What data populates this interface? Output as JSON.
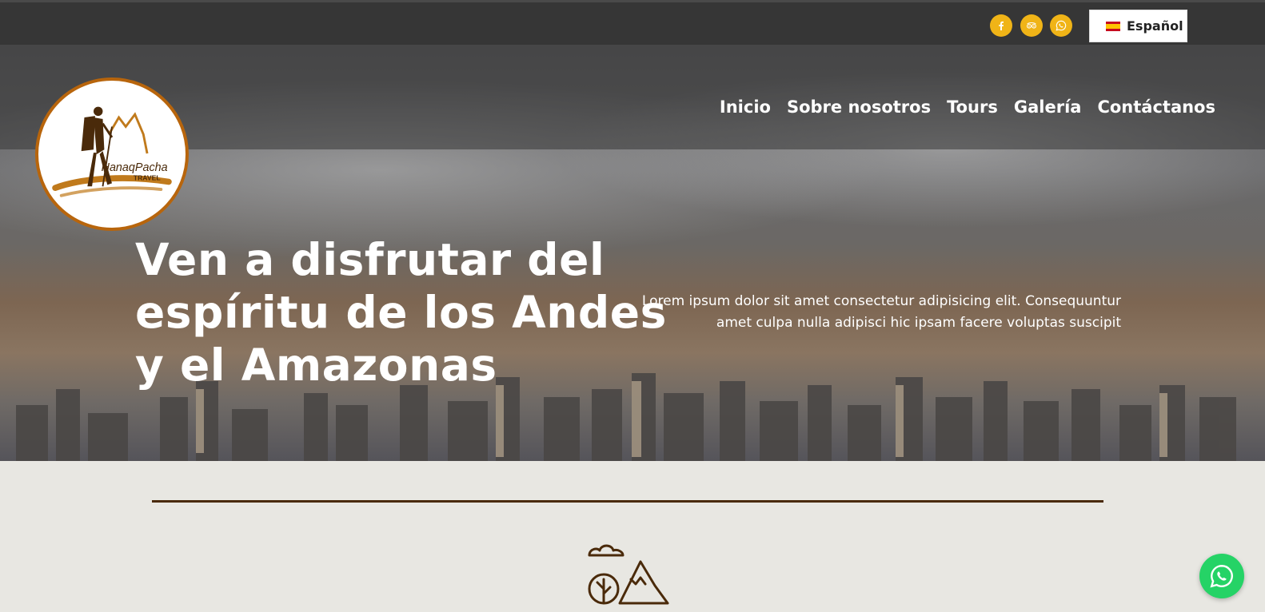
{
  "topbar": {
    "social": [
      {
        "name": "facebook-icon"
      },
      {
        "name": "tripadvisor-icon"
      },
      {
        "name": "whatsapp-icon"
      }
    ],
    "language": {
      "label": "Español",
      "flag": "spain-flag-icon"
    }
  },
  "nav": {
    "items": [
      "Inicio",
      "Sobre nosotros",
      "Tours",
      "Galería",
      "Contáctanos"
    ]
  },
  "logo": {
    "brand_line1": "HanaqPacha",
    "brand_line2": "TRAVEL"
  },
  "hero": {
    "headline_lines": [
      "Ven a disfrutar del",
      "espíritu de los Andes",
      "y el Amazonas"
    ],
    "lead_lines": [
      "Lorem ipsum dolor sit amet consectetur adipisicing elit. Consequuntur",
      "amet culpa nulla adipisci hic ipsam facere voluptas suscipit"
    ]
  },
  "colors": {
    "accent": "#f0b417",
    "brand_brown": "#b8650c",
    "dark_brown": "#4a2a0a",
    "topbar": "#363636",
    "whatsapp": "#25d366"
  },
  "floating": {
    "icon": "whatsapp-float-icon"
  }
}
